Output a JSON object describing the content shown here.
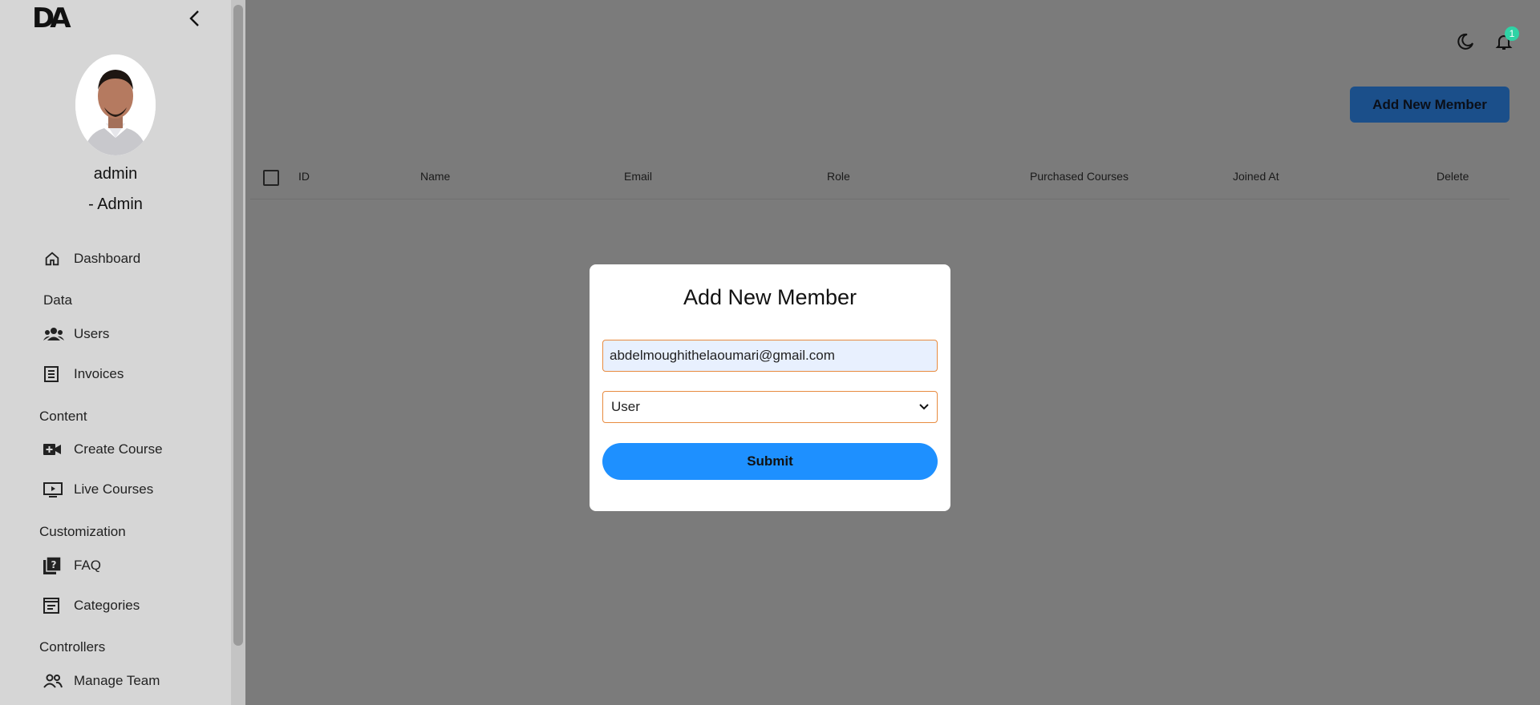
{
  "sidebar": {
    "logo": "DA",
    "user_name": "admin",
    "user_role": "- Admin",
    "nav": {
      "dashboard": "Dashboard",
      "section_data": "Data",
      "users": "Users",
      "invoices": "Invoices",
      "section_content": "Content",
      "create_course": "Create Course",
      "live_courses": "Live Courses",
      "section_customization": "Customization",
      "faq": "FAQ",
      "categories": "Categories",
      "section_controllers": "Controllers",
      "manage_team": "Manage Team"
    }
  },
  "header": {
    "notification_count": "1",
    "add_member_label": "Add New Member"
  },
  "table": {
    "columns": [
      "ID",
      "Name",
      "Email",
      "Role",
      "Purchased Courses",
      "Joined At",
      "Delete"
    ]
  },
  "modal": {
    "title": "Add New Member",
    "email_value": "abdelmoughithelaoumari@gmail.com",
    "role_value": "User",
    "submit_label": "Submit"
  },
  "colors": {
    "accent": "#1e90ff",
    "add_button": "#1b4f8a",
    "badge": "#2fd3a5",
    "input_border": "#e88b3f"
  }
}
